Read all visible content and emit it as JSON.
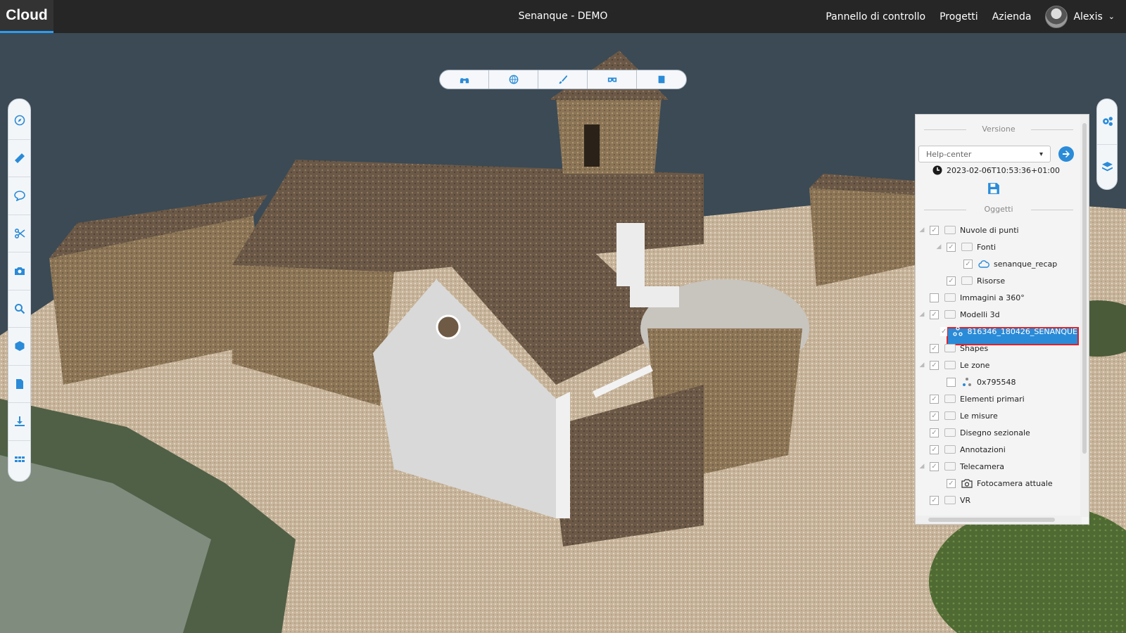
{
  "app": {
    "brand": "Cloud",
    "project_title": "Senanque - DEMO"
  },
  "nav": {
    "items": [
      "Pannello di controllo",
      "Progetti",
      "Azienda"
    ],
    "user_name": "Alexis"
  },
  "toolbar_top": [
    "binoculars-icon",
    "globe-icon",
    "brush-icon",
    "vr-headset-icon",
    "book-icon"
  ],
  "toolbar_left": [
    "compass-icon",
    "ruler-icon",
    "comment-icon",
    "scissors-icon",
    "camera-icon",
    "search-icon",
    "cube-icon",
    "file-export-icon",
    "download-icon",
    "grid-icon"
  ],
  "toolbar_right": [
    "settings-icon",
    "layers-icon"
  ],
  "panel": {
    "version_title": "Versione",
    "version_selected": "Help-center",
    "timestamp": "2023-02-06T10:53:36+01:00",
    "objects_title": "Oggetti",
    "tree": [
      {
        "label": "Nuvole di punti",
        "level": 0,
        "checked": true
      },
      {
        "label": "Fonti",
        "level": 1,
        "checked": true
      },
      {
        "label": "senanque_recap",
        "level": 2,
        "checked": true,
        "icon": "cloud-icon"
      },
      {
        "label": "Risorse",
        "level": 1,
        "checked": true
      },
      {
        "label": "Immagini a 360°",
        "level": 0,
        "checked": false
      },
      {
        "label": "Modelli 3d",
        "level": 0,
        "checked": true
      },
      {
        "label": "816346_180426_SENANQUE",
        "level": 1,
        "checked": true,
        "icon": "model-icon",
        "selected": true
      },
      {
        "label": "Shapes",
        "level": 0,
        "checked": true
      },
      {
        "label": "Le zone",
        "level": 0,
        "checked": true
      },
      {
        "label": "0x795548",
        "level": 1,
        "checked": false,
        "icon": "model-icon"
      },
      {
        "label": "Elementi primari",
        "level": 0,
        "checked": true
      },
      {
        "label": "Le misure",
        "level": 0,
        "checked": true
      },
      {
        "label": "Disegno sezionale",
        "level": 0,
        "checked": true
      },
      {
        "label": "Annotazioni",
        "level": 0,
        "checked": true
      },
      {
        "label": "Telecamera",
        "level": 0,
        "checked": true
      },
      {
        "label": "Fotocamera attuale",
        "level": 1,
        "checked": true,
        "icon": "camera-icon"
      },
      {
        "label": "VR",
        "level": 0,
        "checked": true
      }
    ]
  },
  "colors": {
    "accent": "#2a8bd8",
    "topbar": "#262626",
    "highlight": "#e0202a"
  }
}
